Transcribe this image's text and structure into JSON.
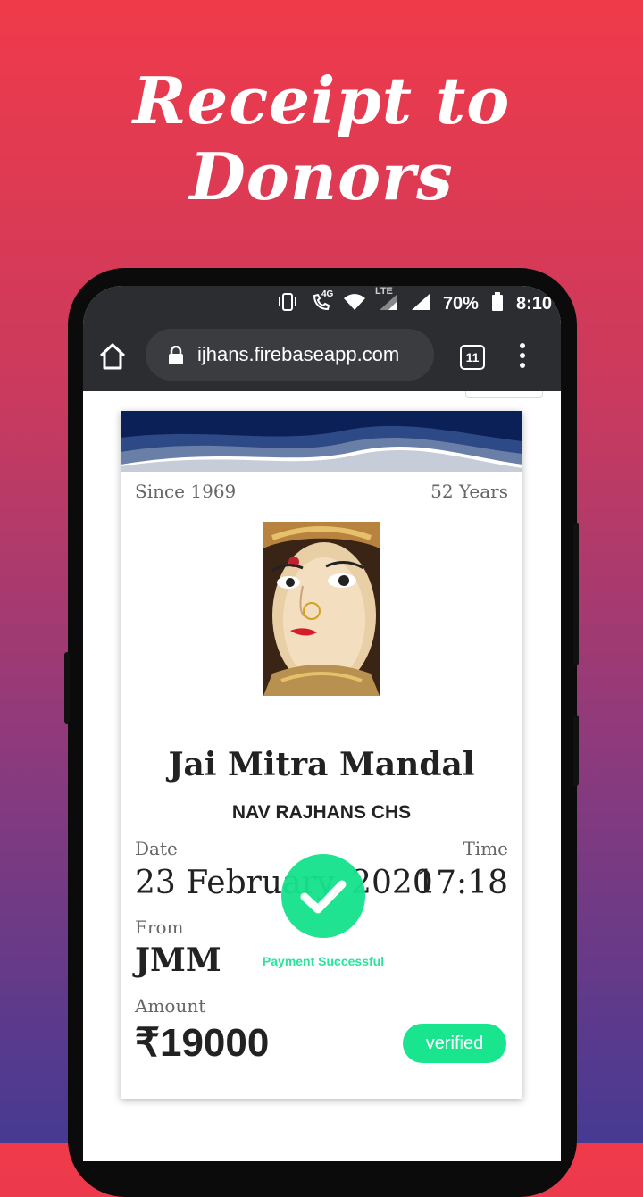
{
  "headline": "Receipt to Donors",
  "status_bar": {
    "network": "4G",
    "lte": "LTE",
    "battery": "70%",
    "time": "8:10"
  },
  "browser": {
    "url": "ijhans.firebaseapp.com",
    "tab_count": "11"
  },
  "receipt": {
    "since": "Since 1969",
    "years": "52 Years",
    "title": "Jai Mitra Mandal",
    "subtitle": "NAV RAJHANS CHS",
    "date_label": "Date",
    "date_value": "23 February, 2020",
    "time_label": "Time",
    "time_value": "17:18",
    "from_label": "From",
    "from_value": "JMM",
    "amount_label": "Amount",
    "amount_value": "₹19000",
    "payment_status": "Payment Successful",
    "verified_label": "verified"
  },
  "colors": {
    "accent_green": "#19e58f",
    "header_navy": "#0b2057"
  }
}
